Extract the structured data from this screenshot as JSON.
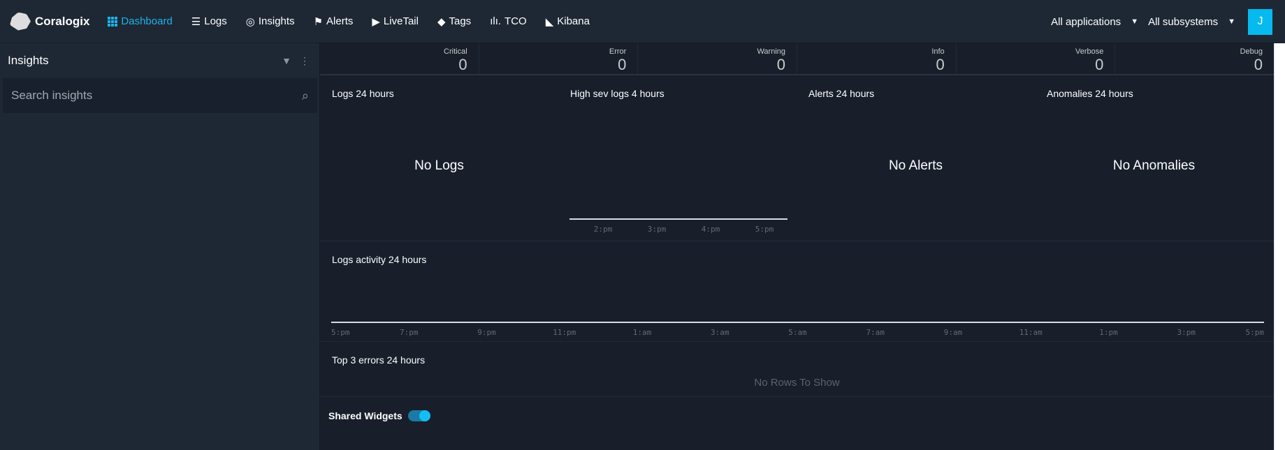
{
  "nav": {
    "brand": "Coralogix",
    "items": [
      {
        "label": "Dashboard",
        "icon": "grid-icon",
        "active": true
      },
      {
        "label": "Logs",
        "icon": "database-icon"
      },
      {
        "label": "Insights",
        "icon": "target-icon"
      },
      {
        "label": "Alerts",
        "icon": "flag-icon"
      },
      {
        "label": "LiveTail",
        "icon": "play-icon"
      },
      {
        "label": "Tags",
        "icon": "tag-icon"
      },
      {
        "label": "TCO",
        "icon": "bar-chart-icon"
      },
      {
        "label": "Kibana",
        "icon": "kibana-icon"
      }
    ],
    "applications": "All applications",
    "subsystems": "All subsystems",
    "avatar": "J"
  },
  "sidebar": {
    "title": "Insights",
    "search_placeholder": "Search insights"
  },
  "stats": [
    {
      "label": "Critical",
      "value": "0"
    },
    {
      "label": "Error",
      "value": "0"
    },
    {
      "label": "Warning",
      "value": "0"
    },
    {
      "label": "Info",
      "value": "0"
    },
    {
      "label": "Verbose",
      "value": "0"
    },
    {
      "label": "Debug",
      "value": "0"
    }
  ],
  "widgets": {
    "logs": {
      "title": "Logs 24 hours",
      "empty": "No Logs"
    },
    "high_sev": {
      "title": "High sev logs 4 hours",
      "ticks": [
        "2:pm",
        "3:pm",
        "4:pm",
        "5:pm"
      ]
    },
    "alerts": {
      "title": "Alerts 24 hours",
      "empty": "No Alerts"
    },
    "anomalies": {
      "title": "Anomalies 24 hours",
      "empty": "No Anomalies"
    }
  },
  "activity": {
    "title": "Logs activity 24 hours",
    "ticks": [
      "5:pm",
      "7:pm",
      "9:pm",
      "11:pm",
      "1:am",
      "3:am",
      "5:am",
      "7:am",
      "9:am",
      "11:am",
      "1:pm",
      "3:pm",
      "5:pm"
    ]
  },
  "errors": {
    "title": "Top 3 errors 24 hours",
    "empty": "No Rows To Show"
  },
  "shared": {
    "label": "Shared Widgets",
    "enabled": true
  },
  "colors": {
    "accent": "#1fb3e8",
    "nav_bg": "#1e2835",
    "main_bg": "#181f2b"
  }
}
